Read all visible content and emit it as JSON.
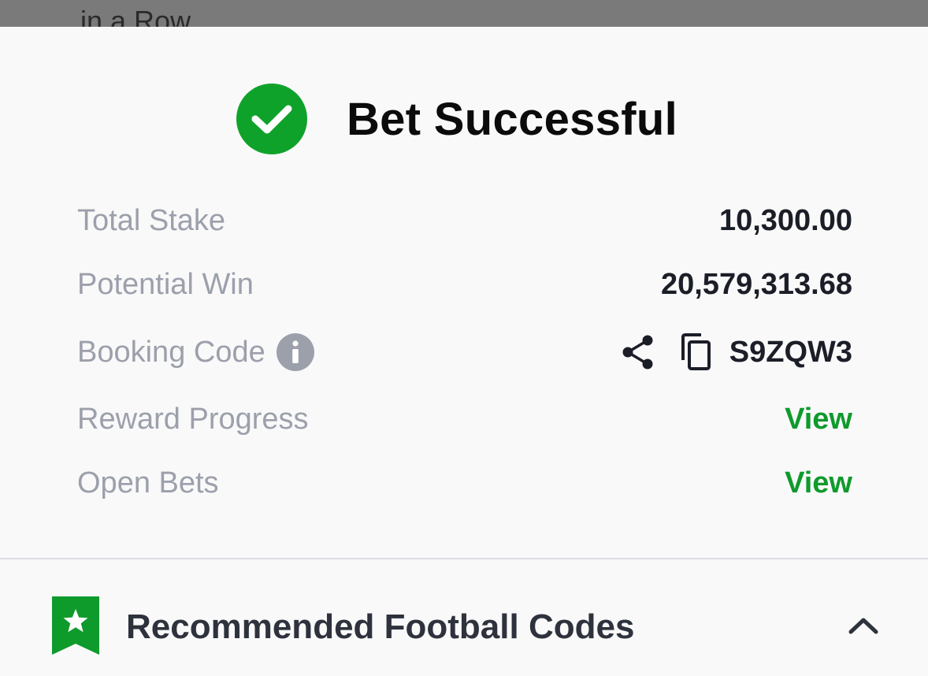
{
  "backdrop": {
    "partial_text": "in a Row"
  },
  "dialog": {
    "title": "Bet Successful",
    "rows": [
      {
        "label": "Total Stake",
        "value": "10,300.00"
      },
      {
        "label": "Potential Win",
        "value": "20,579,313.68"
      },
      {
        "label": "Booking Code",
        "value": "S9ZQW3"
      },
      {
        "label": "Reward Progress",
        "value": "View"
      },
      {
        "label": "Open Bets",
        "value": "View"
      }
    ],
    "icons": {
      "success": "check-circle-icon",
      "info": "info-icon",
      "share": "share-icon",
      "copy": "copy-icon"
    }
  },
  "recommended": {
    "title": "Recommended Football Codes",
    "icons": {
      "badge": "star-bookmark-icon",
      "toggle": "chevron-up-icon"
    }
  },
  "colors": {
    "accent_green": "#0f9a2c",
    "success_green": "#0fa22a",
    "label_gray": "#9ca0ab"
  }
}
